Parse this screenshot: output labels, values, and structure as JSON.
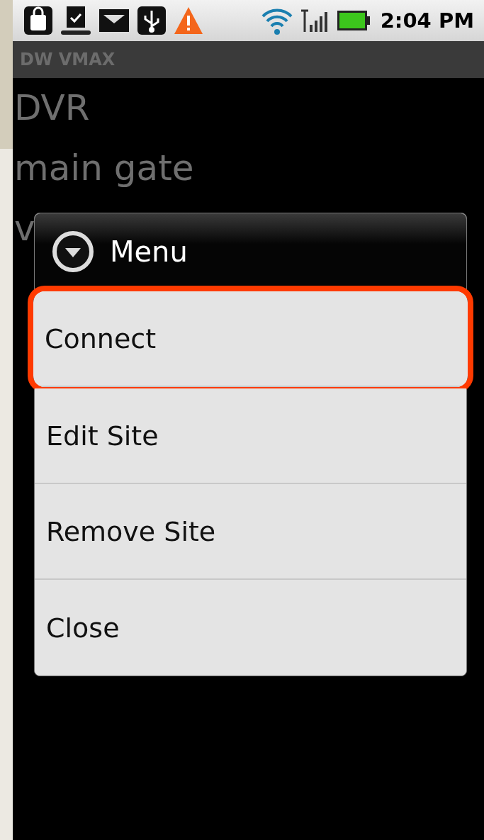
{
  "status_bar": {
    "time": "2:04 PM"
  },
  "app_bar": {
    "title": "DW VMAX"
  },
  "sites": [
    "DVR",
    "main gate",
    "v"
  ],
  "menu": {
    "title": "Menu",
    "items": [
      {
        "label": "Connect",
        "highlighted": true
      },
      {
        "label": "Edit Site",
        "highlighted": false
      },
      {
        "label": "Remove Site",
        "highlighted": false
      },
      {
        "label": "Close",
        "highlighted": false
      }
    ]
  }
}
